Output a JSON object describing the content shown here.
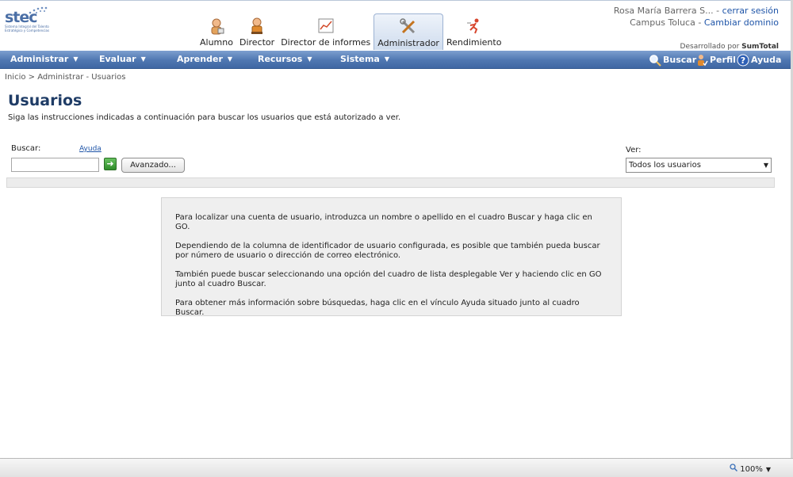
{
  "logo": {
    "word": "stec",
    "tagline": "Sistema Integral del Talento Estratégico y Competencias"
  },
  "roles": [
    {
      "label": "Alumno",
      "icon": "student-icon"
    },
    {
      "label": "Director",
      "icon": "director-icon"
    },
    {
      "label": "Director de informes",
      "icon": "report-chart-icon"
    },
    {
      "label": "Administrador",
      "icon": "tools-icon",
      "active": true
    },
    {
      "label": "Rendimiento",
      "icon": "runner-icon"
    }
  ],
  "user": {
    "name": "Rosa María Barrera S...",
    "sep": " - ",
    "logout": "cerrar sesión",
    "campus": "Campus Toluca",
    "change_domain": "Cambiar dominio"
  },
  "developed_by": {
    "prefix": "Desarrollado por ",
    "brand": "SumTotal"
  },
  "nav": {
    "items": [
      "Administrar",
      "Evaluar",
      "Aprender",
      "Recursos",
      "Sistema"
    ],
    "buscar": "Buscar",
    "perfil": "Perfil",
    "ayuda": "Ayuda"
  },
  "breadcrumb": "Inicio > Administrar - Usuarios",
  "page": {
    "title": "Usuarios",
    "subtitle": "Siga las instrucciones indicadas a continuación para buscar los usuarios que está autorizado a ver."
  },
  "search": {
    "label": "Buscar:",
    "help_link": "Ayuda",
    "value": "",
    "go_glyph": "➜",
    "advanced_label": "Avanzado..."
  },
  "view": {
    "label": "Ver:",
    "selected": "Todos los usuarios"
  },
  "info": [
    "Para localizar una cuenta de usuario, introduzca un nombre o apellido en el cuadro Buscar y haga clic en GO.",
    "Dependiendo de la columna de identificador de usuario configurada, es posible que también pueda buscar por número de usuario o dirección de correo electrónico.",
    "También puede buscar seleccionando una opción del cuadro de lista desplegable Ver y haciendo clic en GO junto al cuadro Buscar.",
    "Para obtener más información sobre búsquedas, haga clic en el vínculo Ayuda situado junto al cuadro Buscar."
  ],
  "status": {
    "zoom": "100%"
  },
  "colors": {
    "nav_blue": "#4f77b1",
    "title_blue": "#1f3c66",
    "link_blue": "#1f55a8",
    "go_green": "#2f8d2a"
  }
}
